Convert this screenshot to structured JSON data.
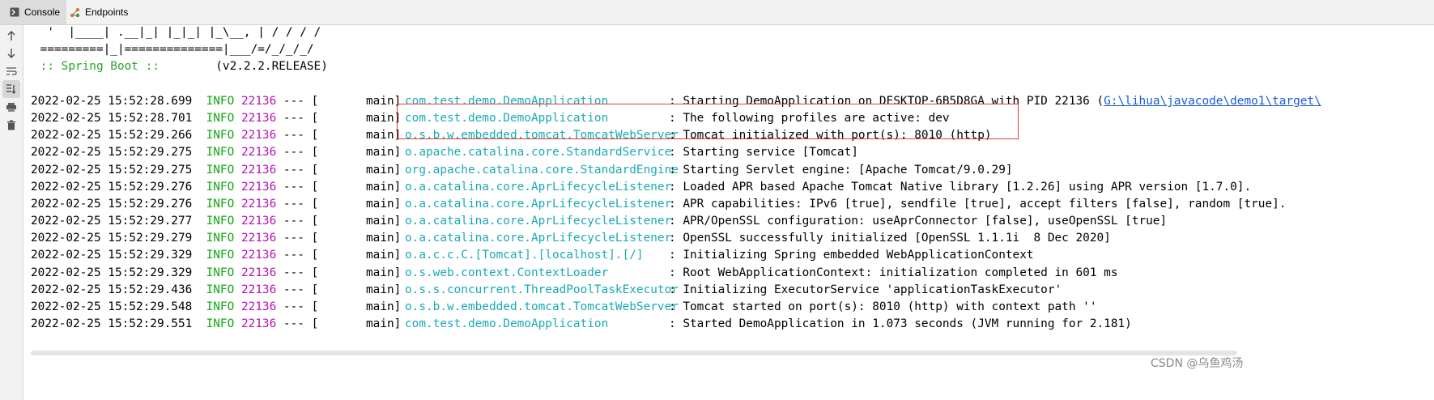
{
  "tabs": [
    {
      "label": "Console",
      "icon": "console-icon",
      "active": true
    },
    {
      "label": "Endpoints",
      "icon": "endpoints-icon",
      "active": false
    }
  ],
  "sidebar_icons": [
    "up-arrow-icon",
    "down-arrow-icon",
    "soft-wrap-icon",
    "scroll-to-end-icon",
    "print-icon",
    "trash-icon"
  ],
  "banner": {
    "line1": "  '  |____| .__|_| |_|_| |_\\__, | / / / /",
    "line2": " =========|_|==============|___/=/_/_/_/",
    "label": " :: Spring Boot ::",
    "version": "        (v2.2.2.RELEASE)"
  },
  "sep": " --- [",
  "thread": "main]",
  "logs": [
    {
      "ts": "2022-02-25 15:52:28.699",
      "level": "INFO",
      "pid": "22136",
      "logger": "com.test.demo.DemoApplication",
      "message": ": Starting DemoApplication on DESKTOP-6B5D8GA with PID 22136 (",
      "link": "G:\\lihua\\javacode\\demo1\\target\\"
    },
    {
      "ts": "2022-02-25 15:52:28.701",
      "level": "INFO",
      "pid": "22136",
      "logger": "com.test.demo.DemoApplication",
      "message": ": The following profiles are active: dev"
    },
    {
      "ts": "2022-02-25 15:52:29.266",
      "level": "INFO",
      "pid": "22136",
      "logger": "o.s.b.w.embedded.tomcat.TomcatWebServer",
      "message": ": Tomcat initialized with port(s): 8010 (http)"
    },
    {
      "ts": "2022-02-25 15:52:29.275",
      "level": "INFO",
      "pid": "22136",
      "logger": "o.apache.catalina.core.StandardService",
      "message": ": Starting service [Tomcat]"
    },
    {
      "ts": "2022-02-25 15:52:29.275",
      "level": "INFO",
      "pid": "22136",
      "logger": "org.apache.catalina.core.StandardEngine",
      "message": ": Starting Servlet engine: [Apache Tomcat/9.0.29]"
    },
    {
      "ts": "2022-02-25 15:52:29.276",
      "level": "INFO",
      "pid": "22136",
      "logger": "o.a.catalina.core.AprLifecycleListener",
      "message": ": Loaded APR based Apache Tomcat Native library [1.2.26] using APR version [1.7.0]."
    },
    {
      "ts": "2022-02-25 15:52:29.276",
      "level": "INFO",
      "pid": "22136",
      "logger": "o.a.catalina.core.AprLifecycleListener",
      "message": ": APR capabilities: IPv6 [true], sendfile [true], accept filters [false], random [true]."
    },
    {
      "ts": "2022-02-25 15:52:29.277",
      "level": "INFO",
      "pid": "22136",
      "logger": "o.a.catalina.core.AprLifecycleListener",
      "message": ": APR/OpenSSL configuration: useAprConnector [false], useOpenSSL [true]"
    },
    {
      "ts": "2022-02-25 15:52:29.279",
      "level": "INFO",
      "pid": "22136",
      "logger": "o.a.catalina.core.AprLifecycleListener",
      "message": ": OpenSSL successfully initialized [OpenSSL 1.1.1i  8 Dec 2020]"
    },
    {
      "ts": "2022-02-25 15:52:29.329",
      "level": "INFO",
      "pid": "22136",
      "logger": "o.a.c.c.C.[Tomcat].[localhost].[/]",
      "message": ": Initializing Spring embedded WebApplicationContext"
    },
    {
      "ts": "2022-02-25 15:52:29.329",
      "level": "INFO",
      "pid": "22136",
      "logger": "o.s.web.context.ContextLoader",
      "message": ": Root WebApplicationContext: initialization completed in 601 ms"
    },
    {
      "ts": "2022-02-25 15:52:29.436",
      "level": "INFO",
      "pid": "22136",
      "logger": "o.s.s.concurrent.ThreadPoolTaskExecutor",
      "message": ": Initializing ExecutorService 'applicationTaskExecutor'"
    },
    {
      "ts": "2022-02-25 15:52:29.548",
      "level": "INFO",
      "pid": "22136",
      "logger": "o.s.b.w.embedded.tomcat.TomcatWebServer",
      "message": ": Tomcat started on port(s): 8010 (http) with context path ''"
    },
    {
      "ts": "2022-02-25 15:52:29.551",
      "level": "INFO",
      "pid": "22136",
      "logger": "com.test.demo.DemoApplication",
      "message": ": Started DemoApplication in 1.073 seconds (JVM running for 2.181)"
    }
  ],
  "watermark": "CSDN @乌鱼鸡汤",
  "colors": {
    "level": "#12a712",
    "pid": "#b316b3",
    "logger": "#1aaab3",
    "spring_label": "#2aa32a",
    "link": "#1a5cd6",
    "highlight_border": "#e23b3b"
  }
}
